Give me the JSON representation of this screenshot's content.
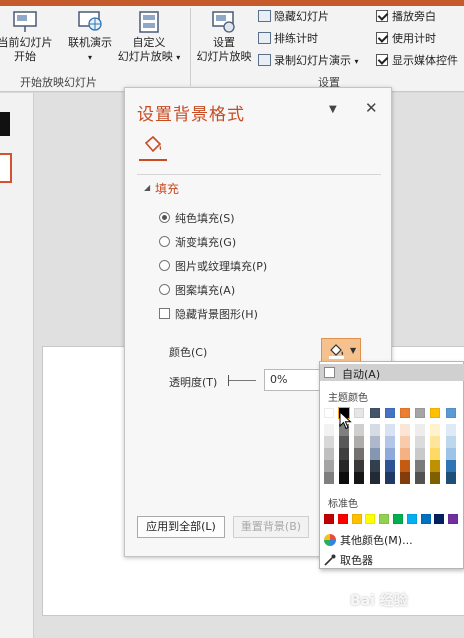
{
  "ribbon": {
    "from_current_label": [
      "当前幻灯片",
      "开始"
    ],
    "online_present_label": "联机演示",
    "custom_show_label": [
      "自定义",
      "幻灯片放映"
    ],
    "setup_show_label": [
      "设置",
      "幻灯片放映"
    ],
    "hide_slide_label": "隐藏幻灯片",
    "rehearse_label": "排练计时",
    "record_label": "录制幻灯片演示",
    "play_narrations_label": "播放旁白",
    "use_timings_label": "使用计时",
    "show_media_controls_label": "显示媒体控件",
    "group_start_label": "开始放映幻灯片",
    "group_setup_label": "设置"
  },
  "pane": {
    "title": "设置背景格式",
    "fill_section": "填充",
    "options": [
      "纯色填充(S)",
      "渐变填充(G)",
      "图片或纹理填充(P)",
      "图案填充(A)"
    ],
    "hide_bg_graphics": "隐藏背景图形(H)",
    "color_label": "颜色(C)",
    "transparency_label": "透明度(T)",
    "transparency_value": "0%",
    "apply_all_label": "应用到全部(L)",
    "reset_label": "重置背景(B)"
  },
  "color_picker": {
    "automatic_label": "自动(A)",
    "theme_colors_label": "主题颜色",
    "standard_colors_label": "标准色",
    "more_colors_label": "其他颜色(M)...",
    "eyedropper_label": "取色器",
    "theme_base": [
      "#ffffff",
      "#000000",
      "#e7e6e6",
      "#44546a",
      "#4472c4",
      "#ed7d31",
      "#a5a5a5",
      "#ffc000",
      "#5b9bd5"
    ],
    "theme_shades": [
      [
        "#f2f2f2",
        "#7f7f7f",
        "#d0cece",
        "#d6dce4",
        "#d9e2f3",
        "#fbe5d5",
        "#ededed",
        "#fff2cc",
        "#deeaf6"
      ],
      [
        "#d8d8d8",
        "#595959",
        "#aeabab",
        "#adb9ca",
        "#b4c6e7",
        "#f7cbac",
        "#dbdbdb",
        "#fee599",
        "#bdd7ee"
      ],
      [
        "#bfbfbf",
        "#3f3f3f",
        "#757070",
        "#8496b0",
        "#8eaadb",
        "#f4b183",
        "#c9c9c9",
        "#ffd965",
        "#9dc3e6"
      ],
      [
        "#a5a5a5",
        "#262626",
        "#3a3838",
        "#323f4f",
        "#2f5496",
        "#c55a11",
        "#7b7b7b",
        "#bf9000",
        "#2e75b5"
      ],
      [
        "#7f7f7f",
        "#0c0c0c",
        "#171616",
        "#222a35",
        "#1f3864",
        "#833c0b",
        "#525252",
        "#7f6000",
        "#1f4e79"
      ]
    ],
    "standard": [
      "#c00000",
      "#ff0000",
      "#ffc000",
      "#ffff00",
      "#92d050",
      "#00b050",
      "#00b0f0",
      "#0070c0",
      "#002060",
      "#7030a0"
    ]
  },
  "watermark": "Bai 经验"
}
